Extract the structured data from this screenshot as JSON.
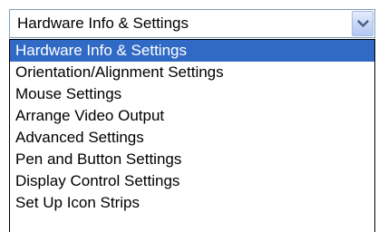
{
  "combo": {
    "value": "Hardware Info & Settings",
    "button_icon": "chevron-down-icon"
  },
  "dropdown": {
    "selected_index": 0,
    "items": [
      "Hardware Info & Settings",
      "Orientation/Alignment Settings",
      "Mouse Settings",
      "Arrange Video Output",
      "Advanced Settings",
      "Pen and Button Settings",
      "Display Control Settings",
      "Set Up Icon Strips"
    ]
  },
  "colors": {
    "selection_bg": "#316ac5",
    "selection_text": "#ffffff",
    "combo_border": "#7f9db9",
    "chevron": "#4d6185"
  }
}
